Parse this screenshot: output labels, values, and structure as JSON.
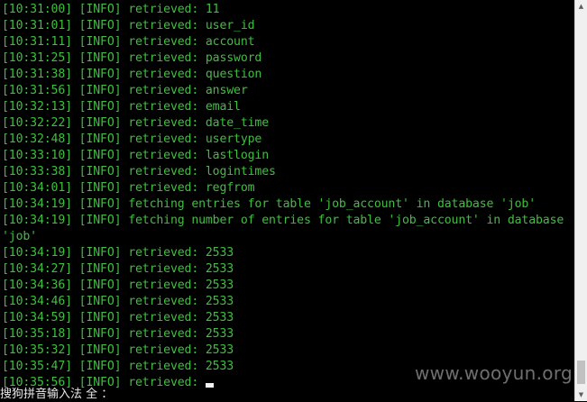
{
  "terminal": {
    "lines": [
      {
        "text": "[10:31:00] [INFO] retrieved: 11"
      },
      {
        "text": "[10:31:01] [INFO] retrieved: user_id"
      },
      {
        "text": "[10:31:11] [INFO] retrieved: account"
      },
      {
        "text": "[10:31:25] [INFO] retrieved: password"
      },
      {
        "text": "[10:31:38] [INFO] retrieved: question"
      },
      {
        "text": "[10:31:56] [INFO] retrieved: answer"
      },
      {
        "text": "[10:32:13] [INFO] retrieved: email"
      },
      {
        "text": "[10:32:22] [INFO] retrieved: date_time"
      },
      {
        "text": "[10:32:48] [INFO] retrieved: usertype"
      },
      {
        "text": "[10:33:10] [INFO] retrieved: lastlogin"
      },
      {
        "text": "[10:33:38] [INFO] retrieved: logintimes"
      },
      {
        "text": "[10:34:01] [INFO] retrieved: regfrom"
      },
      {
        "text": "[10:34:19] [INFO] fetching entries for table 'job_account' in database 'job'"
      },
      {
        "text": "[10:34:19] [INFO] fetching number of entries for table 'job_account' in database"
      },
      {
        "text": "'job'"
      },
      {
        "text": "[10:34:19] [INFO] retrieved: 2533"
      },
      {
        "text": "[10:34:27] [INFO] retrieved: 2533"
      },
      {
        "text": "[10:34:36] [INFO] retrieved: 2533"
      },
      {
        "text": "[10:34:46] [INFO] retrieved: 2533"
      },
      {
        "text": "[10:34:59] [INFO] retrieved: 2533"
      },
      {
        "text": "[10:35:18] [INFO] retrieved: 2533"
      },
      {
        "text": "[10:35:32] [INFO] retrieved: 2533"
      },
      {
        "text": "[10:35:47] [INFO] retrieved: 2533"
      },
      {
        "text": "[10:35:56] [INFO] retrieved:"
      }
    ],
    "text_color": "#3fbf3f",
    "background": "#000000"
  },
  "ime_status": "搜狗拼音输入法 全 ：",
  "watermark": "www.wooyun.org",
  "scrollbar": {
    "up_icon": "scroll-up-arrow-icon",
    "down_icon": "scroll-down-arrow-icon"
  }
}
